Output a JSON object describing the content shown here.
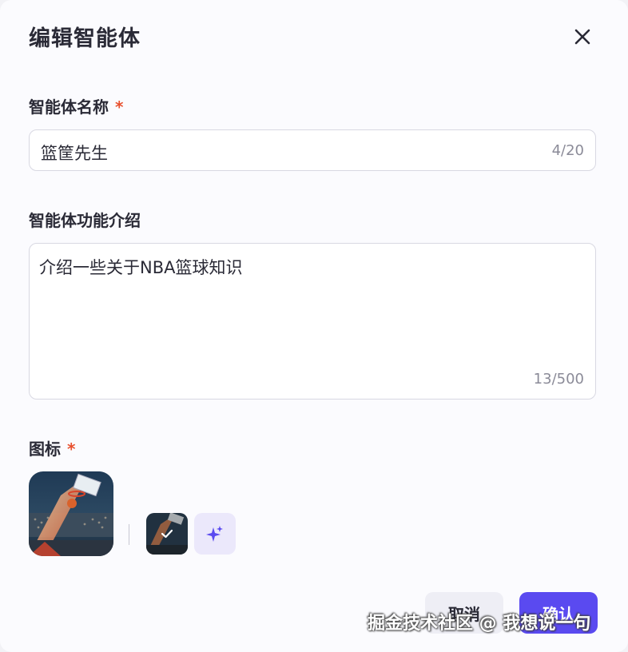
{
  "dialog": {
    "title": "编辑智能体",
    "close_icon": "close-icon"
  },
  "name_field": {
    "label": "智能体名称",
    "required_mark": "*",
    "value": "篮筐先生",
    "counter": "4/20"
  },
  "description_field": {
    "label": "智能体功能介绍",
    "value": "介绍一些关于NBA篮球知识",
    "counter": "13/500"
  },
  "icon_field": {
    "label": "图标",
    "required_mark": "*",
    "selected_icon": "basketball-arena-image",
    "options_icon": "check-icon",
    "generate_icon": "sparkle-icon"
  },
  "footer": {
    "cancel_label": "取消",
    "confirm_label": "确认"
  },
  "watermark": "掘金技术社区 @ 我想说一句",
  "colors": {
    "accent": "#5a4af0",
    "required": "#e8502e",
    "generate_bg": "#ebe8fb"
  }
}
